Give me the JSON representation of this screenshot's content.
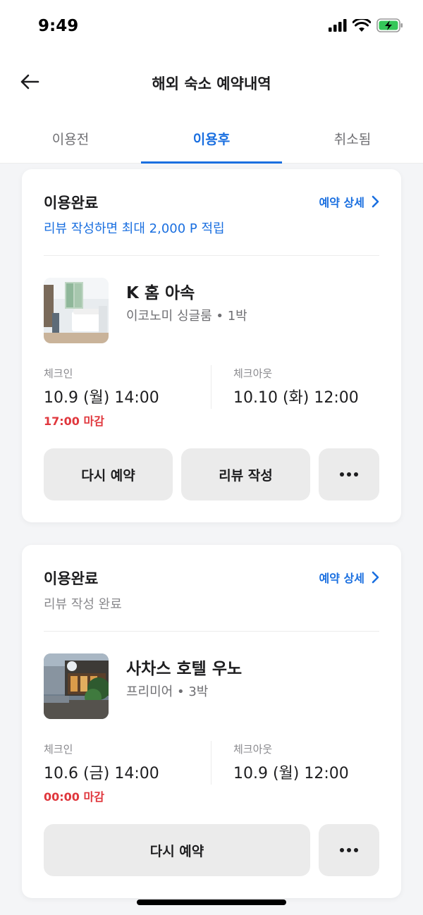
{
  "status_bar": {
    "time": "9:49"
  },
  "header": {
    "title": "해외 숙소 예약내역"
  },
  "tabs": [
    {
      "label": "이용전",
      "active": false
    },
    {
      "label": "이용후",
      "active": true
    },
    {
      "label": "취소됨",
      "active": false
    }
  ],
  "colors": {
    "accent": "#1a6fe0",
    "deadline": "#e0373d",
    "button_bg": "#ebebeb"
  },
  "bookings": [
    {
      "status": "이용완료",
      "detail_link": "예약 상세",
      "sub_text": "리뷰 작성하면 최대 2,000 P 적립",
      "hotel_name": "K 홈 아속",
      "room_type": "이코노미 싱글룸",
      "nights": "1박",
      "checkin_label": "체크인",
      "checkin": "10.9 (월) 14:00",
      "checkout_label": "체크아웃",
      "checkout": "10.10 (화) 12:00",
      "deadline": "17:00 마감",
      "buttons": [
        "다시 예약",
        "리뷰 작성"
      ]
    },
    {
      "status": "이용완료",
      "detail_link": "예약 상세",
      "sub_text": "리뷰 작성 완료",
      "hotel_name": "사차스 호텔 우노",
      "room_type": "프리미어",
      "nights": "3박",
      "checkin_label": "체크인",
      "checkin": "10.6 (금) 14:00",
      "checkout_label": "체크아웃",
      "checkout": "10.9 (월) 12:00",
      "deadline": "00:00 마감",
      "buttons": [
        "다시 예약"
      ]
    }
  ]
}
